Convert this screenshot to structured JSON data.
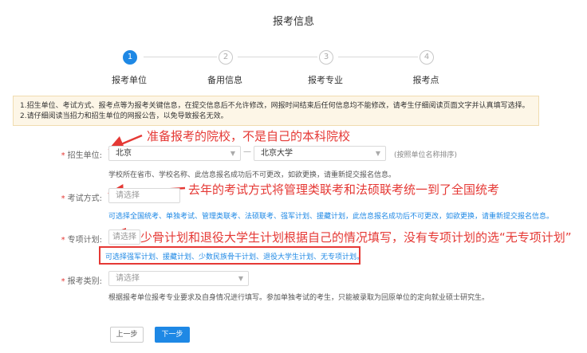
{
  "page_title": "报考信息",
  "steps": [
    {
      "num": "1",
      "label": "报考单位",
      "active": true
    },
    {
      "num": "2",
      "label": "备用信息",
      "active": false
    },
    {
      "num": "3",
      "label": "报考专业",
      "active": false
    },
    {
      "num": "4",
      "label": "报考点",
      "active": false
    }
  ],
  "notice": {
    "line1": "1.招生单位、考试方式、报考点等为报考关键信息，在提交信息后不允许修改，网报时间结束后任何信息均不能修改，请考生仔细阅读页面文字并认真填写选择。",
    "line2": "2.请仔细阅读当招力和招生单位的网报公告，以免导致报名无效。"
  },
  "annotations": {
    "a1": "准备报考的院校，不是自己的本科院校",
    "a2": "去年的考试方式将管理类联考和法硕联考统一到了全国统考",
    "a3": "少骨计划和退役大学生计划根据自己的情况填写，没有专项计划的选“无专项计划”"
  },
  "form": {
    "unit": {
      "label": "招生单位:",
      "province": "北京",
      "separator": "—",
      "school": "北京大学",
      "sort_hint": "(按照单位名称排序)",
      "hint": "学校所在省市、学校名称、此信息报名成功后不可更改，如欲更换，请重新提交报名信息。"
    },
    "exam_method": {
      "label": "考试方式:",
      "placeholder": "请选择",
      "hint": "可选择全国统考、单独考试、管理类联考、法硕联考、强军计划、援藏计划，此信息报名成功后不可更改，如欲更换，请重新提交报名信息。"
    },
    "special_plan": {
      "label": "专项计划:",
      "placeholder": "请选择",
      "hint": "可选择强军计划、援藏计划、少数民族骨干计划、退役大学生计划、无专项计划。"
    },
    "apply_type": {
      "label": "报考类别:",
      "placeholder": "请选择",
      "hint": "根据报考单位报考专业要求及自身情况进行填写。参加单独考试的考生，只能被录取为回原单位的定向就业硕士研究生。"
    }
  },
  "buttons": {
    "prev": "上一步",
    "next": "下一步"
  },
  "colors": {
    "accent": "#1e88e5",
    "annotation": "#e53935",
    "notice_bg": "#fdf6e7"
  }
}
